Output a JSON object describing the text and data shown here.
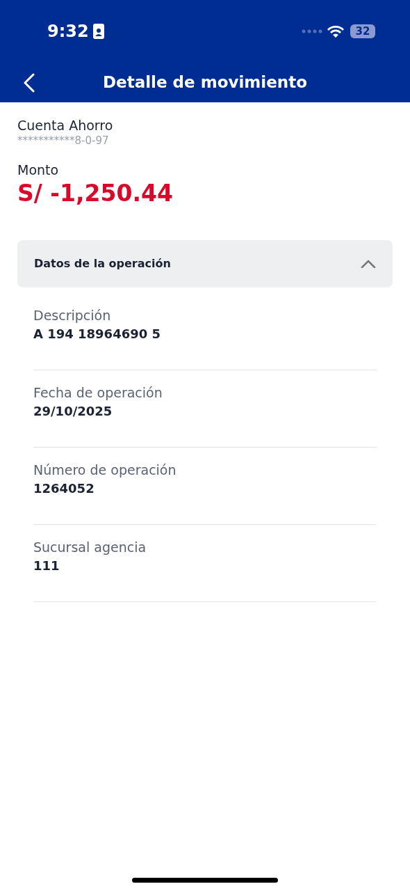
{
  "status_bar": {
    "time": "9:32",
    "battery": "32"
  },
  "header": {
    "title": "Detalle de movimiento"
  },
  "account": {
    "name": "Cuenta Ahorro",
    "number": "***********8-0-97"
  },
  "amount": {
    "label": "Monto",
    "value": "S/ -1,250.44"
  },
  "section": {
    "title": "Datos de la operación",
    "expanded": true,
    "fields": [
      {
        "label": "Descripción",
        "value": "A 194 18964690 5"
      },
      {
        "label": "Fecha de operación",
        "value": "29/10/2025"
      },
      {
        "label": "Número de operación",
        "value": "1264052"
      },
      {
        "label": "Sucursal agencia",
        "value": "111"
      }
    ]
  }
}
